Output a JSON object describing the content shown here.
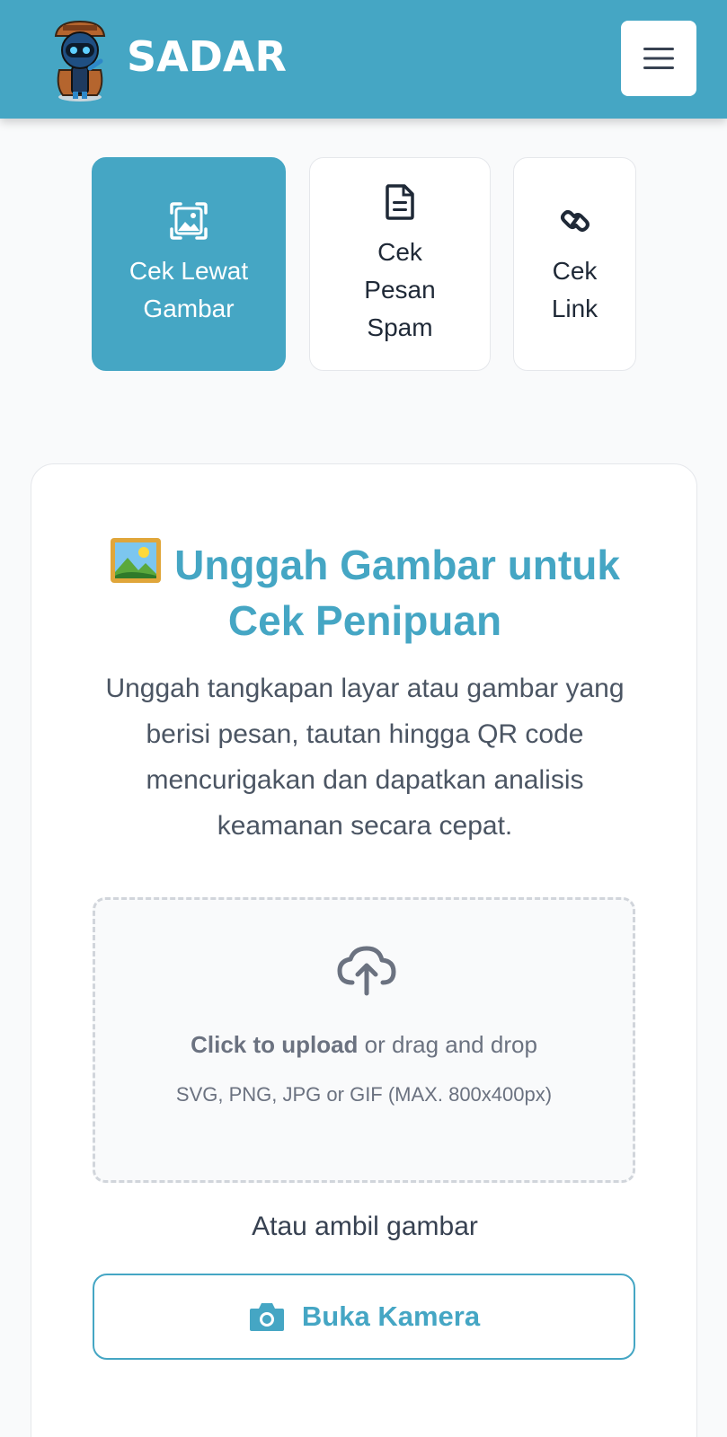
{
  "app": {
    "brand": "SADAR",
    "logo": "detective-robot-logo"
  },
  "header": {
    "menu_icon": "hamburger-menu-icon"
  },
  "tabs": [
    {
      "label_line1": "Cek Lewat",
      "label_line2": "Gambar",
      "label_line3": "",
      "icon": "image-icon",
      "active": true
    },
    {
      "label_line1": "Cek",
      "label_line2": "Pesan",
      "label_line3": "Spam",
      "icon": "document-icon",
      "active": false
    },
    {
      "label_line1": "Cek",
      "label_line2": "Link",
      "label_line3": "",
      "icon": "link-icon",
      "active": false
    }
  ],
  "card": {
    "title_emoji": "framed-picture-emoji",
    "title_line1": "Unggah Gambar untuk",
    "title_line2": "Cek Penipuan",
    "description": "Unggah tangkapan layar atau gambar yang berisi pesan, tautan hingga QR code mencurigakan dan dapatkan analisis keamanan secara cepat."
  },
  "upload": {
    "icon": "cloud-upload-icon",
    "click_label": "Click to upload",
    "drag_label": " or drag and drop",
    "formats": "SVG, PNG, JPG or GIF (MAX. 800x400px)"
  },
  "camera": {
    "or_label": "Atau ambil gambar",
    "button_label": "Buka Kamera",
    "icon": "camera-icon"
  },
  "colors": {
    "primary": "#45a6c4",
    "text": "#374151",
    "muted": "#6b7280"
  }
}
